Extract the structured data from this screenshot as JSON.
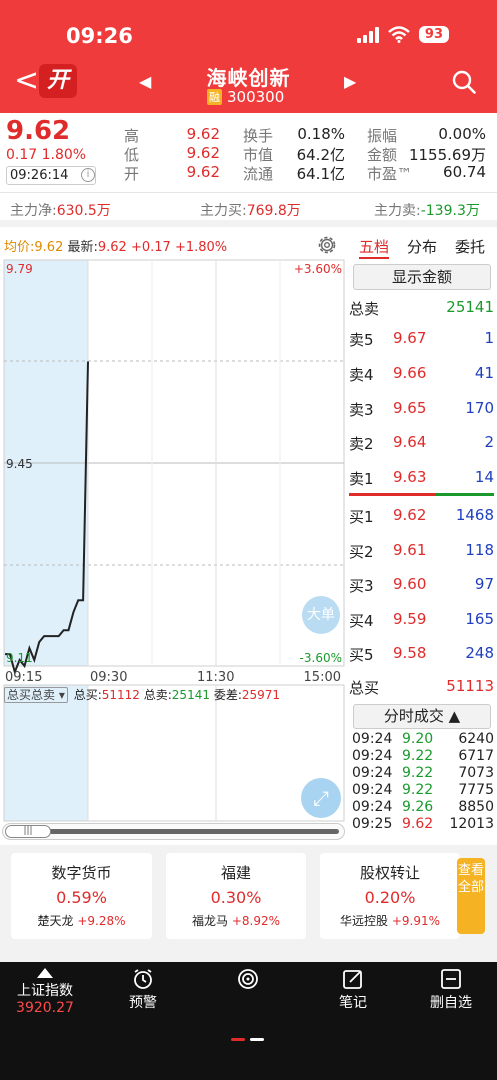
{
  "status_bar": {
    "time": "09:26",
    "battery": "93"
  },
  "header": {
    "open_badge": "开",
    "stock_name": "海峡创新",
    "margin_badge": "融",
    "stock_code": "300300"
  },
  "quote": {
    "last": "9.62",
    "change": "0.17",
    "change_pct": "1.80%",
    "time": "09:26:14",
    "fields": [
      {
        "label": "高",
        "value": "9.62"
      },
      {
        "label": "低",
        "value": "9.62"
      },
      {
        "label": "开",
        "value": "9.62"
      },
      {
        "label": "换手",
        "value": "0.18%"
      },
      {
        "label": "市值",
        "value": "64.2亿"
      },
      {
        "label": "流通",
        "value": "64.1亿"
      },
      {
        "label": "振幅",
        "value": "0.00%"
      },
      {
        "label": "金额",
        "value": "1155.69万"
      },
      {
        "label": "市盈™",
        "value": "60.74"
      }
    ]
  },
  "fund_flow": {
    "net_label": "主力净:",
    "net_value": "630.5万",
    "buy_label": "主力买:",
    "buy_value": "769.8万",
    "sell_label": "主力卖:",
    "sell_value": "-139.3万"
  },
  "chart_header": {
    "avg_label": "均价:",
    "avg_value": "9.62",
    "latest_label": "最新:",
    "latest_value": "9.62",
    "chg": "+0.17",
    "chg_pct": "+1.80%"
  },
  "chart_data": {
    "type": "line",
    "price_labels": {
      "top": "9.79",
      "mid": "9.45",
      "bottom": "9.11"
    },
    "pct_labels": {
      "top": "+3.60%",
      "bottom": "-3.60%"
    },
    "x_ticks": [
      "09:15",
      "09:30",
      "11:30",
      "15:00"
    ],
    "ylim": [
      9.11,
      9.79
    ],
    "series": [
      {
        "values": [
          9.13,
          9.13,
          9.1,
          9.12,
          9.11,
          9.14,
          9.12,
          9.15,
          9.16,
          9.16,
          9.16,
          9.16,
          9.17,
          9.17,
          9.2,
          9.22,
          9.22,
          9.62
        ]
      }
    ],
    "big_order_label": "大单"
  },
  "volume": {
    "selector": "总买总卖",
    "buy_label": "总买:",
    "buy_value": "51112",
    "sell_label": "总卖:",
    "sell_value": "25141",
    "diff_label": "委差:",
    "diff_value": "25971"
  },
  "order_book": {
    "tabs": [
      "五档",
      "分布",
      "委托"
    ],
    "show_amount": "显示金额",
    "total_sell_label": "总卖",
    "total_sell": "25141",
    "asks": [
      {
        "label": "卖5",
        "price": "9.67",
        "vol": "1"
      },
      {
        "label": "卖4",
        "price": "9.66",
        "vol": "41"
      },
      {
        "label": "卖3",
        "price": "9.65",
        "vol": "170"
      },
      {
        "label": "卖2",
        "price": "9.64",
        "vol": "2"
      },
      {
        "label": "卖1",
        "price": "9.63",
        "vol": "14"
      }
    ],
    "bids": [
      {
        "label": "买1",
        "price": "9.62",
        "vol": "1468"
      },
      {
        "label": "买2",
        "price": "9.61",
        "vol": "118"
      },
      {
        "label": "买3",
        "price": "9.60",
        "vol": "97"
      },
      {
        "label": "买4",
        "price": "9.59",
        "vol": "165"
      },
      {
        "label": "买5",
        "price": "9.58",
        "vol": "248"
      }
    ],
    "total_buy_label": "总买",
    "total_buy": "51113",
    "ticks_button": "分时成交 ▲",
    "ticks": [
      {
        "time": "09:24",
        "price": "9.20",
        "vol": "6240"
      },
      {
        "time": "09:24",
        "price": "9.22",
        "vol": "6717"
      },
      {
        "time": "09:24",
        "price": "9.22",
        "vol": "7073"
      },
      {
        "time": "09:24",
        "price": "9.22",
        "vol": "7775"
      },
      {
        "time": "09:24",
        "price": "9.26",
        "vol": "8850"
      },
      {
        "time": "09:25",
        "price": "9.62",
        "vol": "12013"
      }
    ]
  },
  "sectors": [
    {
      "name": "数字货币",
      "change": "0.59%",
      "leader": "楚天龙",
      "leader_chg": "+9.28%"
    },
    {
      "name": "福建",
      "change": "0.30%",
      "leader": "福龙马",
      "leader_chg": "+8.92%"
    },
    {
      "name": "股权转让",
      "change": "0.20%",
      "leader": "华远控股",
      "leader_chg": "+9.91%"
    }
  ],
  "view_all": "查看全部",
  "bottom_bar": {
    "index_name": "上证指数",
    "index_value": "3920.27",
    "items": [
      "预警",
      "笔记",
      "删自选"
    ]
  },
  "colors": {
    "header_red": "#ef3b3b",
    "up_red": "#e02b2b",
    "down_green": "#1a9a2c",
    "volume_blue": "#1f3fbf",
    "accent_yellow": "#f5b324"
  }
}
